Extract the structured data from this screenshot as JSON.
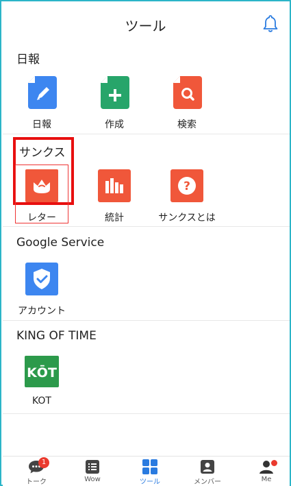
{
  "header": {
    "title": "ツール"
  },
  "sections": {
    "nippo": {
      "title": "日報",
      "items": [
        "日報",
        "作成",
        "検索"
      ]
    },
    "thanks": {
      "title": "サンクス",
      "items": [
        "レター",
        "統計",
        "サンクスとは"
      ]
    },
    "google": {
      "title": "Google Service",
      "items": [
        "アカウント"
      ]
    },
    "kot": {
      "title": "KING OF TIME",
      "items": [
        "KOT"
      ],
      "logo_text": "KŌT"
    }
  },
  "tabbar": {
    "tabs": [
      {
        "label": "トーク",
        "badge": "1"
      },
      {
        "label": "Wow"
      },
      {
        "label": "ツール",
        "active": true
      },
      {
        "label": "メンバー"
      },
      {
        "label": "Me"
      }
    ]
  },
  "colors": {
    "blue": "#3d86f0",
    "green": "#27a56a",
    "orange": "#f0573a",
    "kot_green": "#2c9a4b",
    "accent": "#2a7be0",
    "highlight": "#e80f0f"
  }
}
